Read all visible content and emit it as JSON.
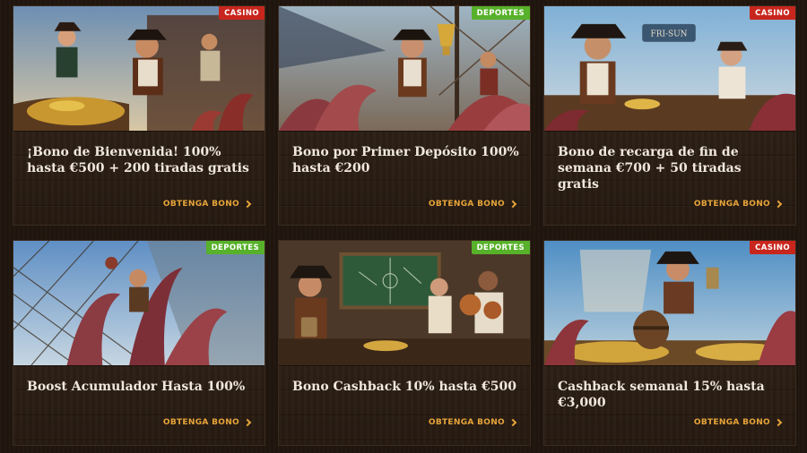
{
  "cards": [
    {
      "badge": "CASINO",
      "badge_type": "casino",
      "title": "¡Bono de Bienvenida! 100% hasta €500 + 200 tiradas gratis",
      "cta": "OBTENGA BONO",
      "scene": "pirate-captain-treasure"
    },
    {
      "badge": "DEPORTES",
      "badge_type": "deportes",
      "title": "Bono por Primer Depósito 100% hasta €200",
      "cta": "OBTENGA BONO",
      "scene": "pirate-trophy-kraken"
    },
    {
      "badge": "CASINO",
      "badge_type": "casino",
      "title": "Bono de recarga de fin de semana €700 + 50 tiradas gratis",
      "cta": "OBTENGA BONO",
      "scene": "pirate-harbor-coins",
      "sign_text": "FRI-SUN"
    },
    {
      "badge": "DEPORTES",
      "badge_type": "deportes",
      "title": "Boost Acumulador Hasta 100%",
      "cta": "OBTENGA BONO",
      "scene": "kraken-rigging"
    },
    {
      "badge": "DEPORTES",
      "badge_type": "deportes",
      "title": "Bono Cashback 10% hasta €500",
      "cta": "OBTENGA BONO",
      "scene": "pirates-tactics-board"
    },
    {
      "badge": "CASINO",
      "badge_type": "casino",
      "title": "Cashback semanal 15% hasta €3,000",
      "cta": "OBTENGA BONO",
      "scene": "pirate-barrel-coins"
    }
  ],
  "colors": {
    "casino_badge": "#c8261d",
    "deportes_badge": "#57b12a",
    "cta": "#e7a53a",
    "title": "#f1e8dc",
    "card_bg": "#2a1d14"
  },
  "icons": {
    "cta": "chevron-right-icon"
  }
}
